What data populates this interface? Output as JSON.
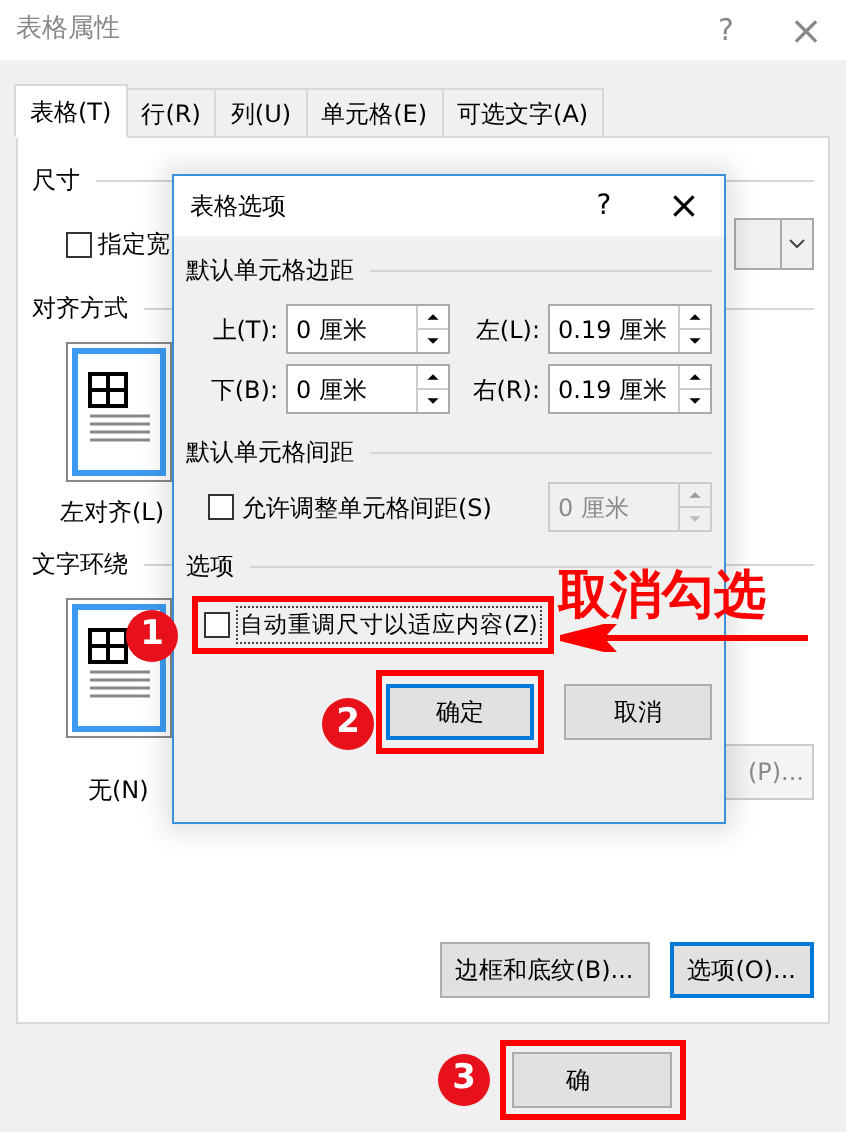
{
  "window": {
    "title": "表格属性",
    "help": "?",
    "close": "×"
  },
  "tabs": [
    {
      "label": "表格(T)",
      "selected": true
    },
    {
      "label": "行(R)",
      "selected": false
    },
    {
      "label": "列(U)",
      "selected": false
    },
    {
      "label": "单元格(E)",
      "selected": false
    },
    {
      "label": "可选文字(A)",
      "selected": false
    }
  ],
  "size": {
    "heading": "尺寸",
    "checkbox": {
      "label": "指定宽",
      "checked": false
    }
  },
  "alignment": {
    "heading": "对齐方式",
    "option": {
      "label": "左对齐(L)",
      "selected": true
    }
  },
  "wrapping": {
    "heading": "文字环绕",
    "option": {
      "label": "无(N)",
      "selected": true
    },
    "position_button": {
      "label": "(P)...",
      "disabled": true
    }
  },
  "panel_buttons": [
    {
      "label": "边框和底纹(B)...",
      "focused": false
    },
    {
      "label": "选项(O)...",
      "focused": true
    }
  ],
  "footer_buttons": [
    {
      "label": "确"
    }
  ],
  "options_dialog": {
    "title": "表格选项",
    "help": "?",
    "close": "×",
    "margins_heading": "默认单元格边距",
    "margins": [
      {
        "label": "上(T):",
        "value": "0 厘米"
      },
      {
        "label": "左(L):",
        "value": "0.19 厘米"
      },
      {
        "label": "下(B):",
        "value": "0 厘米"
      },
      {
        "label": "右(R):",
        "value": "0.19 厘米"
      }
    ],
    "spacing_heading": "默认单元格间距",
    "spacing": {
      "label": "允许调整单元格间距(S)",
      "checked": false,
      "value": "0 厘米",
      "disabled": true
    },
    "options_heading": "选项",
    "autofit": {
      "label": "自动重调尺寸以适应内容(Z)",
      "checked": false
    },
    "buttons": [
      {
        "label": "确定",
        "default": true
      },
      {
        "label": "取消",
        "default": false
      }
    ]
  },
  "annotations": [
    {
      "kind": "step",
      "text": "1"
    },
    {
      "kind": "step",
      "text": "2"
    },
    {
      "kind": "step",
      "text": "3"
    },
    {
      "kind": "callout",
      "text": "取消勾选"
    }
  ]
}
